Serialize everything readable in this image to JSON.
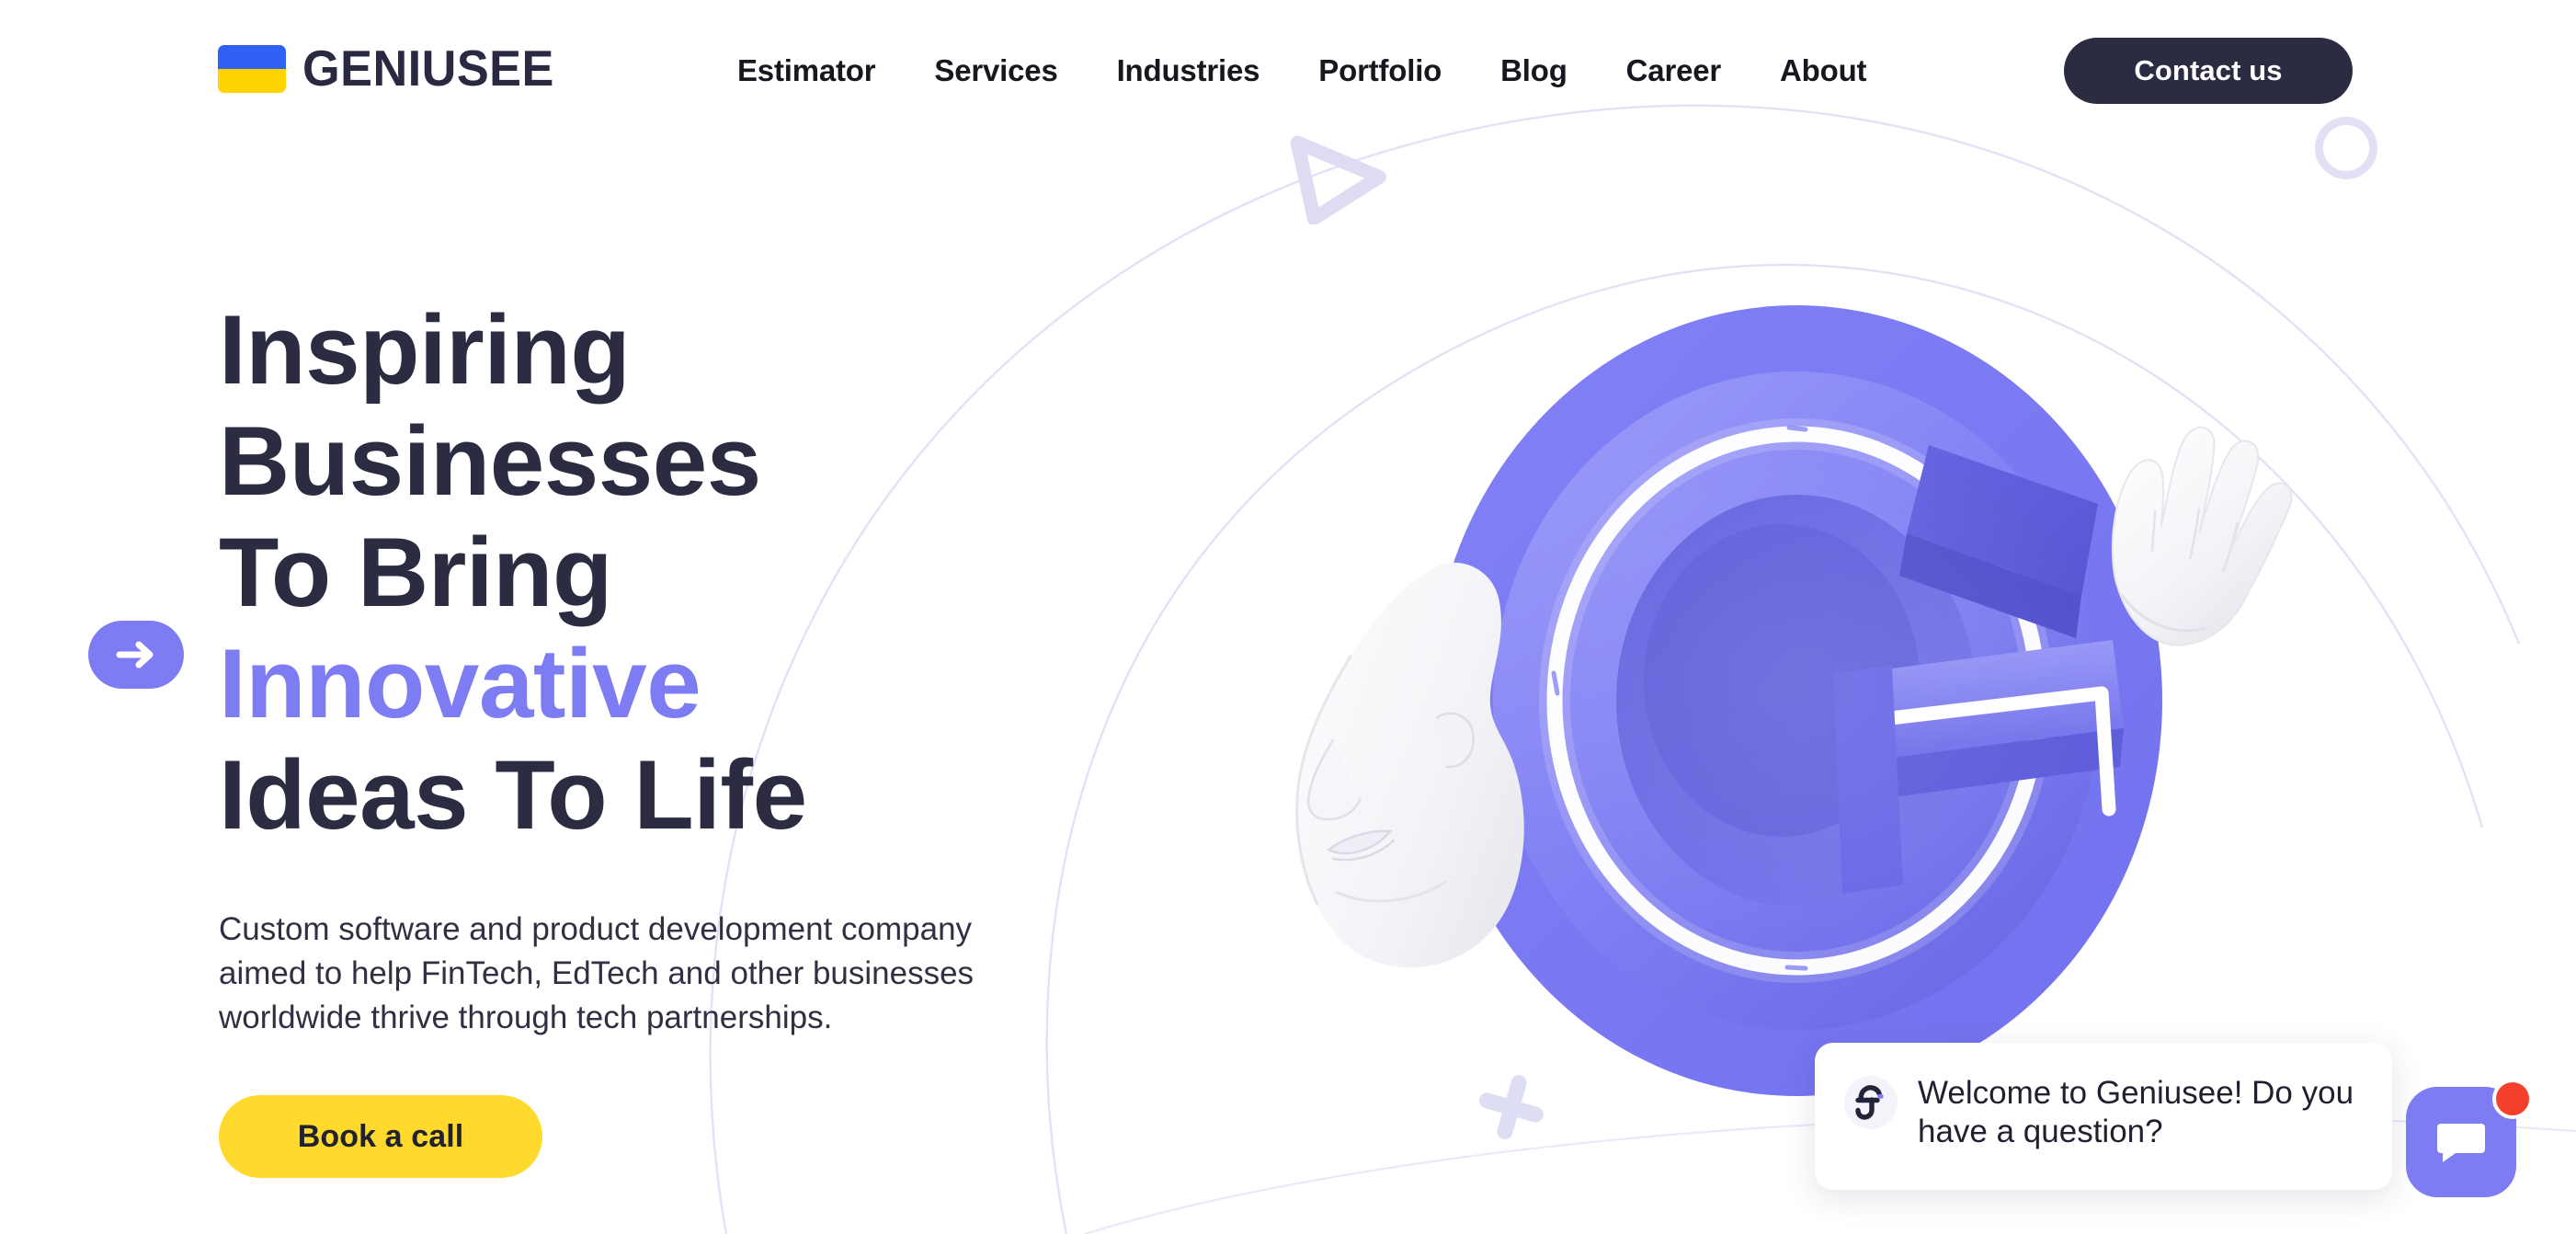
{
  "brand": {
    "name": "GENIUSEE",
    "flag_top_color": "#2f62f4",
    "flag_bottom_color": "#ffd400"
  },
  "nav": {
    "items": [
      {
        "label": "Estimator"
      },
      {
        "label": "Services"
      },
      {
        "label": "Industries"
      },
      {
        "label": "Portfolio"
      },
      {
        "label": "Blog"
      },
      {
        "label": "Career"
      },
      {
        "label": "About"
      }
    ],
    "cta_label": "Contact us"
  },
  "hero": {
    "headline_lines": [
      {
        "text": "Inspiring",
        "accent": false
      },
      {
        "text": "Businesses",
        "accent": false
      },
      {
        "text": "To Bring",
        "accent": false
      },
      {
        "text": "Innovative",
        "accent": true
      },
      {
        "text": "Ideas To Life",
        "accent": false
      }
    ],
    "paragraph": "Custom software and product development company aimed to help FinTech, EdTech and other businesses worldwide thrive through tech partnerships.",
    "cta_label": "Book a call",
    "arrow_badge_icon": "arrow-right-icon"
  },
  "chat": {
    "message": "Welcome to Geniusee! Do you have a question?",
    "avatar_icon": "geniusee-g-icon",
    "launcher_icon": "chat-bubble-icon",
    "unread_badge": true
  },
  "decorations": [
    {
      "name": "play-triangle-outline",
      "color": "#dedcf2"
    },
    {
      "name": "circle-ring-outline",
      "color": "#e2e0f5"
    },
    {
      "name": "plus-sparkle",
      "color": "#ddddf4"
    },
    {
      "name": "orbit-arc-lines",
      "color": "#e6e3f8"
    }
  ],
  "colors": {
    "accent_purple": "#7d7cf2",
    "dark_navy": "#2b2c42",
    "yellow": "#ffd92b",
    "notification_red": "#f5402c",
    "lavender": "#dedcf2"
  },
  "hero_art": {
    "name": "3d-neon-g-letter-with-marble-bust-and-hand",
    "blob_color": "#7d7cf2"
  }
}
